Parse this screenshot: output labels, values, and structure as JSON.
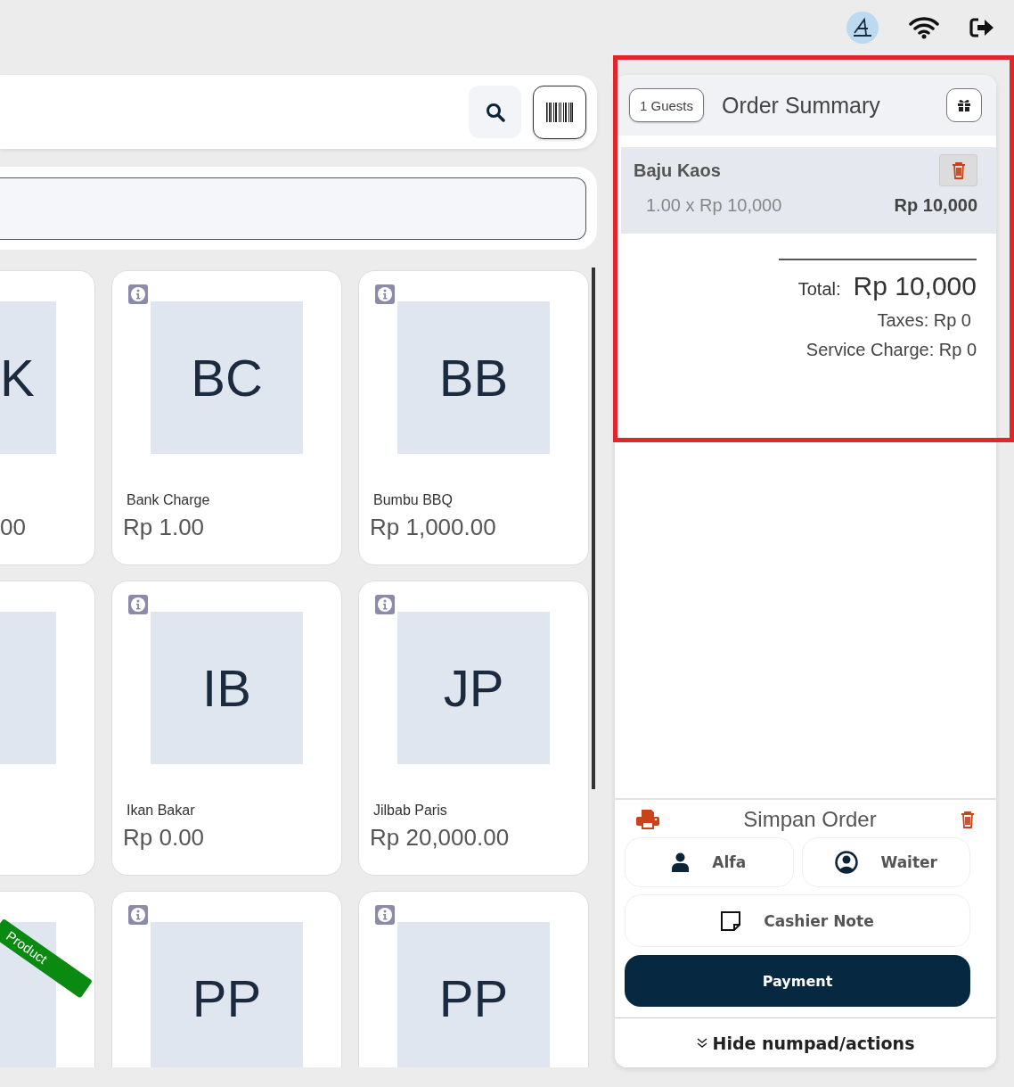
{
  "products": [
    {
      "kind": "partial",
      "initials": "K",
      "price": "00"
    },
    {
      "kind": "full",
      "initials": "BC",
      "name": "Bank Charge",
      "price": "Rp 1.00"
    },
    {
      "kind": "full",
      "initials": "BB",
      "name": "Bumbu BBQ",
      "price": "Rp 1,000.00"
    },
    {
      "kind": "partial"
    },
    {
      "kind": "full",
      "initials": "IB",
      "name": "Ikan Bakar",
      "price": "Rp 0.00"
    },
    {
      "kind": "full",
      "initials": "JP",
      "name": "Jilbab Paris",
      "price": "Rp 20,000.00"
    },
    {
      "kind": "partial",
      "ribbon": "Product"
    },
    {
      "kind": "full",
      "initials": "PP"
    },
    {
      "kind": "full",
      "initials": "PP"
    }
  ],
  "order": {
    "guests": "1 Guests",
    "title": "Order Summary",
    "items": [
      {
        "name": "Baju Kaos",
        "quantity_line": "1.00 x Rp 10,000",
        "amount": "Rp 10,000"
      }
    ],
    "total_label": "Total:",
    "total": "Rp 10,000",
    "taxes": "Taxes: Rp 0",
    "service_charge": "Service Charge: Rp 0"
  },
  "actions": {
    "title": "Simpan Order",
    "customer": "Alfa",
    "waiter": "Waiter",
    "note": "Cashier Note",
    "payment": "Payment",
    "toggle": "Hide numpad/actions"
  }
}
